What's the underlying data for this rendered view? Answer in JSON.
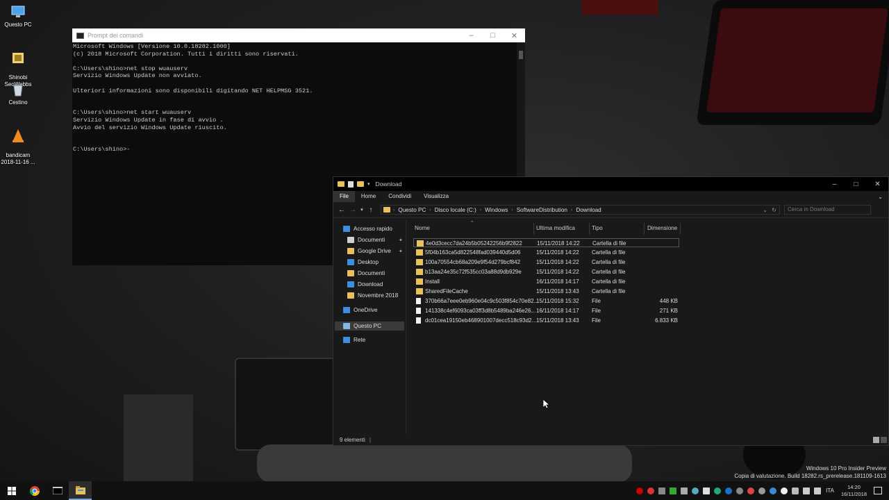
{
  "desktop": {
    "icons": [
      {
        "label": "Questo PC",
        "icon": "monitor-icon"
      },
      {
        "label": "Shinobi\nSeoWebbs",
        "icon": "folder-icon"
      },
      {
        "label": "Cestino",
        "icon": "recycle-bin-icon"
      },
      {
        "label": "bandicam\n2018-11-16 ...",
        "icon": "vlc-cone-icon"
      }
    ],
    "watermark_line1": "Windows 10 Pro Insider Preview",
    "watermark_line2": "Copia di valutazione. Build 18282.rs_prerelease.181109-1613"
  },
  "cmd": {
    "title": "Prompt dei comandi",
    "output": "Microsoft Windows [Versione 10.0.18282.1000]\n(c) 2018 Microsoft Corporation. Tutti i diritti sono riservati.\n\nC:\\Users\\shino>net stop wuauserv\nServizio Windows Update non avviato.\n\nUlteriori informazioni sono disponibili digitando NET HELPMSG 3521.\n\n\nC:\\Users\\shino>net start wuauserv\nServizio Windows Update in fase di avvio .\nAvvio del servizio Windows Update riuscito.\n\n\nC:\\Users\\shino>-"
  },
  "explorer": {
    "title": "Download",
    "ribbon_tabs": [
      "File",
      "Home",
      "Condividi",
      "Visualizza"
    ],
    "breadcrumb": [
      "Questo PC",
      "Disco locale (C:)",
      "Windows",
      "SoftwareDistribution",
      "Download"
    ],
    "search_placeholder": "Cerca in Download",
    "sidebar": [
      {
        "label": "Accesso rapido",
        "icon": "star-icon",
        "color": "#3d8ee0"
      },
      {
        "label": "Documenti",
        "icon": "document-icon",
        "color": "#cfcfcf",
        "pinned": true
      },
      {
        "label": "Google Drive",
        "icon": "google-drive-icon",
        "color": "#e8c15a",
        "pinned": true
      },
      {
        "label": "Desktop",
        "icon": "desktop-icon",
        "color": "#3d8ee0"
      },
      {
        "label": "Documenti",
        "icon": "folder-icon",
        "color": "#e8c15a"
      },
      {
        "label": "Download",
        "icon": "download-icon",
        "color": "#3d8ee0"
      },
      {
        "label": "Novembre 2018",
        "icon": "folder-icon",
        "color": "#e8c15a"
      },
      {
        "label": "OneDrive",
        "icon": "cloud-icon",
        "color": "#3d8ee0"
      },
      {
        "label": "Questo PC",
        "icon": "monitor-icon",
        "color": "#7fb7e8",
        "selected": true
      },
      {
        "label": "Rete",
        "icon": "network-icon",
        "color": "#3d8ee0"
      }
    ],
    "columns": [
      "Nome",
      "Ultima modifica",
      "Tipo",
      "Dimensione"
    ],
    "rows": [
      {
        "name": "4e0d3cecc7da24b5b05242256b9f2822",
        "date": "15/11/2018 14:22",
        "type": "Cartella di file",
        "size": "",
        "kind": "folder"
      },
      {
        "name": "5f04b163ca5d822548fad039440d5d06",
        "date": "15/11/2018 14:22",
        "type": "Cartella di file",
        "size": "",
        "kind": "folder"
      },
      {
        "name": "100a70554cb68a209e9f54d279bcf842",
        "date": "15/11/2018 14:22",
        "type": "Cartella di file",
        "size": "",
        "kind": "folder"
      },
      {
        "name": "b13aa24e35c72f535cc03a88d9db929e",
        "date": "15/11/2018 14:22",
        "type": "Cartella di file",
        "size": "",
        "kind": "folder"
      },
      {
        "name": "Install",
        "date": "16/11/2018 14:17",
        "type": "Cartella di file",
        "size": "",
        "kind": "folder"
      },
      {
        "name": "SharedFileCache",
        "date": "15/11/2018 13:43",
        "type": "Cartella di file",
        "size": "",
        "kind": "folder"
      },
      {
        "name": "370b66a7eee0eb960e04c9c503f854c70e82...",
        "date": "15/11/2018 15:32",
        "type": "File",
        "size": "448 KB",
        "kind": "file"
      },
      {
        "name": "141338c4ef6093ca03ff3d8b5489ba246e26...",
        "date": "16/11/2018 14:17",
        "type": "File",
        "size": "271 KB",
        "kind": "file"
      },
      {
        "name": "dc01cea19150eb468901007decc518c93d2...",
        "date": "15/11/2018 13:43",
        "type": "File",
        "size": "6.833 KB",
        "kind": "file"
      }
    ],
    "status": "9 elementi"
  },
  "taskbar": {
    "apps": [
      "windows-start-icon",
      "chrome-icon",
      "cmd-icon",
      "file-explorer-icon"
    ],
    "language": "ITA",
    "time": "14:20",
    "date": "16/11/2018"
  }
}
